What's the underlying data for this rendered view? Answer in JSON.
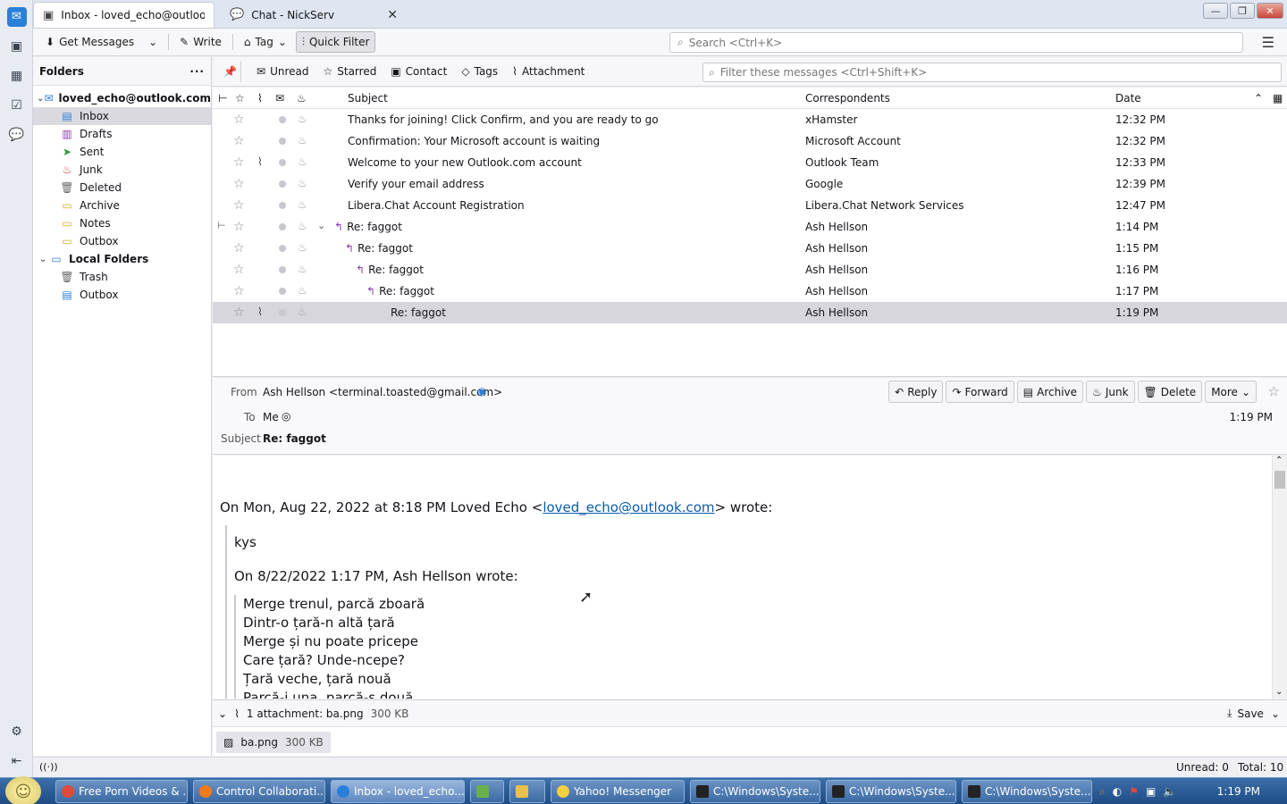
{
  "tabs": [
    {
      "label": "Inbox - loved_echo@outlook.co",
      "icon": "inbox-icon"
    },
    {
      "label": "Chat - NickServ",
      "icon": "chat-icon"
    }
  ],
  "toolbar": {
    "get_messages": "Get Messages",
    "write": "Write",
    "tag": "Tag",
    "quick_filter": "Quick Filter",
    "search_placeholder": "Search <Ctrl+K>"
  },
  "folders": {
    "header": "Folders",
    "account": "loved_echo@outlook.com",
    "items": [
      "Inbox",
      "Drafts",
      "Sent",
      "Junk",
      "Deleted",
      "Archive",
      "Notes",
      "Outbox"
    ],
    "local": "Local Folders",
    "local_items": [
      "Trash",
      "Outbox"
    ]
  },
  "quickfilter": {
    "unread": "Unread",
    "starred": "Starred",
    "contact": "Contact",
    "tags": "Tags",
    "attachment": "Attachment",
    "filter_placeholder": "Filter these messages <Ctrl+Shift+K>"
  },
  "columns": {
    "subject": "Subject",
    "correspondents": "Correspondents",
    "date": "Date"
  },
  "messages": [
    {
      "subject": "Thanks for joining! Click Confirm, and you are ready to go",
      "from": "xHamster",
      "date": "12:32 PM"
    },
    {
      "subject": "Confirmation: Your Microsoft account is waiting",
      "from": "Microsoft Account",
      "date": "12:32 PM"
    },
    {
      "subject": "Welcome to your new Outlook.com account",
      "from": "Outlook Team",
      "date": "12:33 PM"
    },
    {
      "subject": "Verify your email address",
      "from": "Google",
      "date": "12:39 PM"
    },
    {
      "subject": "Libera.Chat Account Registration",
      "from": "Libera.Chat Network Services",
      "date": "12:47 PM"
    },
    {
      "subject": "Re: faggot",
      "from": "Ash Hellson",
      "date": "1:14 PM"
    },
    {
      "subject": "Re: faggot",
      "from": "Ash Hellson",
      "date": "1:15 PM"
    },
    {
      "subject": "Re: faggot",
      "from": "Ash Hellson",
      "date": "1:16 PM"
    },
    {
      "subject": "Re: faggot",
      "from": "Ash Hellson",
      "date": "1:17 PM"
    },
    {
      "subject": "Re: faggot",
      "from": "Ash Hellson",
      "date": "1:19 PM"
    }
  ],
  "header": {
    "from_label": "From",
    "from": "Ash Hellson <terminal.toasted@gmail.com>",
    "to_label": "To",
    "to": "Me",
    "subject_label": "Subject",
    "subject": "Re: faggot",
    "time": "1:19 PM",
    "reply": "Reply",
    "forward": "Forward",
    "archive": "Archive",
    "junk": "Junk",
    "delete": "Delete",
    "more": "More"
  },
  "body": {
    "intro_prefix": "On Mon, Aug 22, 2022 at 8:18 PM Loved Echo <",
    "intro_link": "loved_echo@outlook.com",
    "intro_suffix": "> wrote:",
    "reply_text": "kys",
    "quote_intro": "On 8/22/2022 1:17 PM, Ash Hellson wrote:",
    "poem": [
      "Merge trenul, parcă zboară",
      "Dintr-o țară-n altă țară",
      "Merge și nu poate pricepe",
      "Care țară? Unde-ncepe?",
      "Țară veche, țară nouă",
      "Parcă-i una, parcă-s două"
    ]
  },
  "attachment": {
    "summary": "1 attachment: ba.png",
    "size": "300 KB",
    "save": "Save",
    "name": "ba.png"
  },
  "status": {
    "unread": "Unread: 0",
    "total": "Total: 10"
  },
  "taskbar": {
    "tasks": [
      "Free Porn Videos & ...",
      "Control Collaborati...",
      "Inbox - loved_echo...",
      "",
      "",
      "Yahoo! Messenger",
      "C:\\Windows\\Syste...",
      "C:\\Windows\\Syste...",
      "C:\\Windows\\Syste..."
    ],
    "clock": "1:19 PM"
  }
}
